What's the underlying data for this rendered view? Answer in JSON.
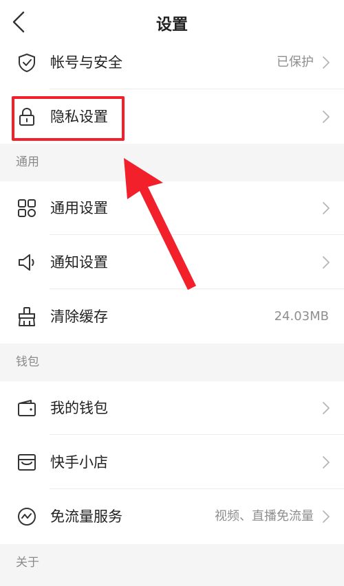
{
  "header": {
    "title": "设置",
    "back_icon": "chevron-left-icon"
  },
  "rows": [
    {
      "icon": "shield-icon",
      "label": "帐号与安全",
      "value": "已保护",
      "chevron": true
    },
    {
      "icon": "lock-icon",
      "label": "隐私设置",
      "value": "",
      "chevron": true
    }
  ],
  "sections": [
    {
      "title": "通用",
      "items": [
        {
          "icon": "grid-icon",
          "label": "通用设置",
          "value": "",
          "chevron": true
        },
        {
          "icon": "speaker-icon",
          "label": "通知设置",
          "value": "",
          "chevron": true
        },
        {
          "icon": "broom-icon",
          "label": "清除缓存",
          "value": "24.03MB",
          "chevron": false
        }
      ]
    },
    {
      "title": "钱包",
      "items": [
        {
          "icon": "wallet-icon",
          "label": "我的钱包",
          "value": "",
          "chevron": true
        },
        {
          "icon": "shop-icon",
          "label": "快手小店",
          "value": "",
          "chevron": true
        },
        {
          "icon": "data-flow-icon",
          "label": "免流量服务",
          "value": "视频、直播免流量",
          "chevron": true
        }
      ]
    },
    {
      "title": "关于",
      "items": []
    }
  ],
  "annotation": {
    "color": "#f1202a"
  }
}
